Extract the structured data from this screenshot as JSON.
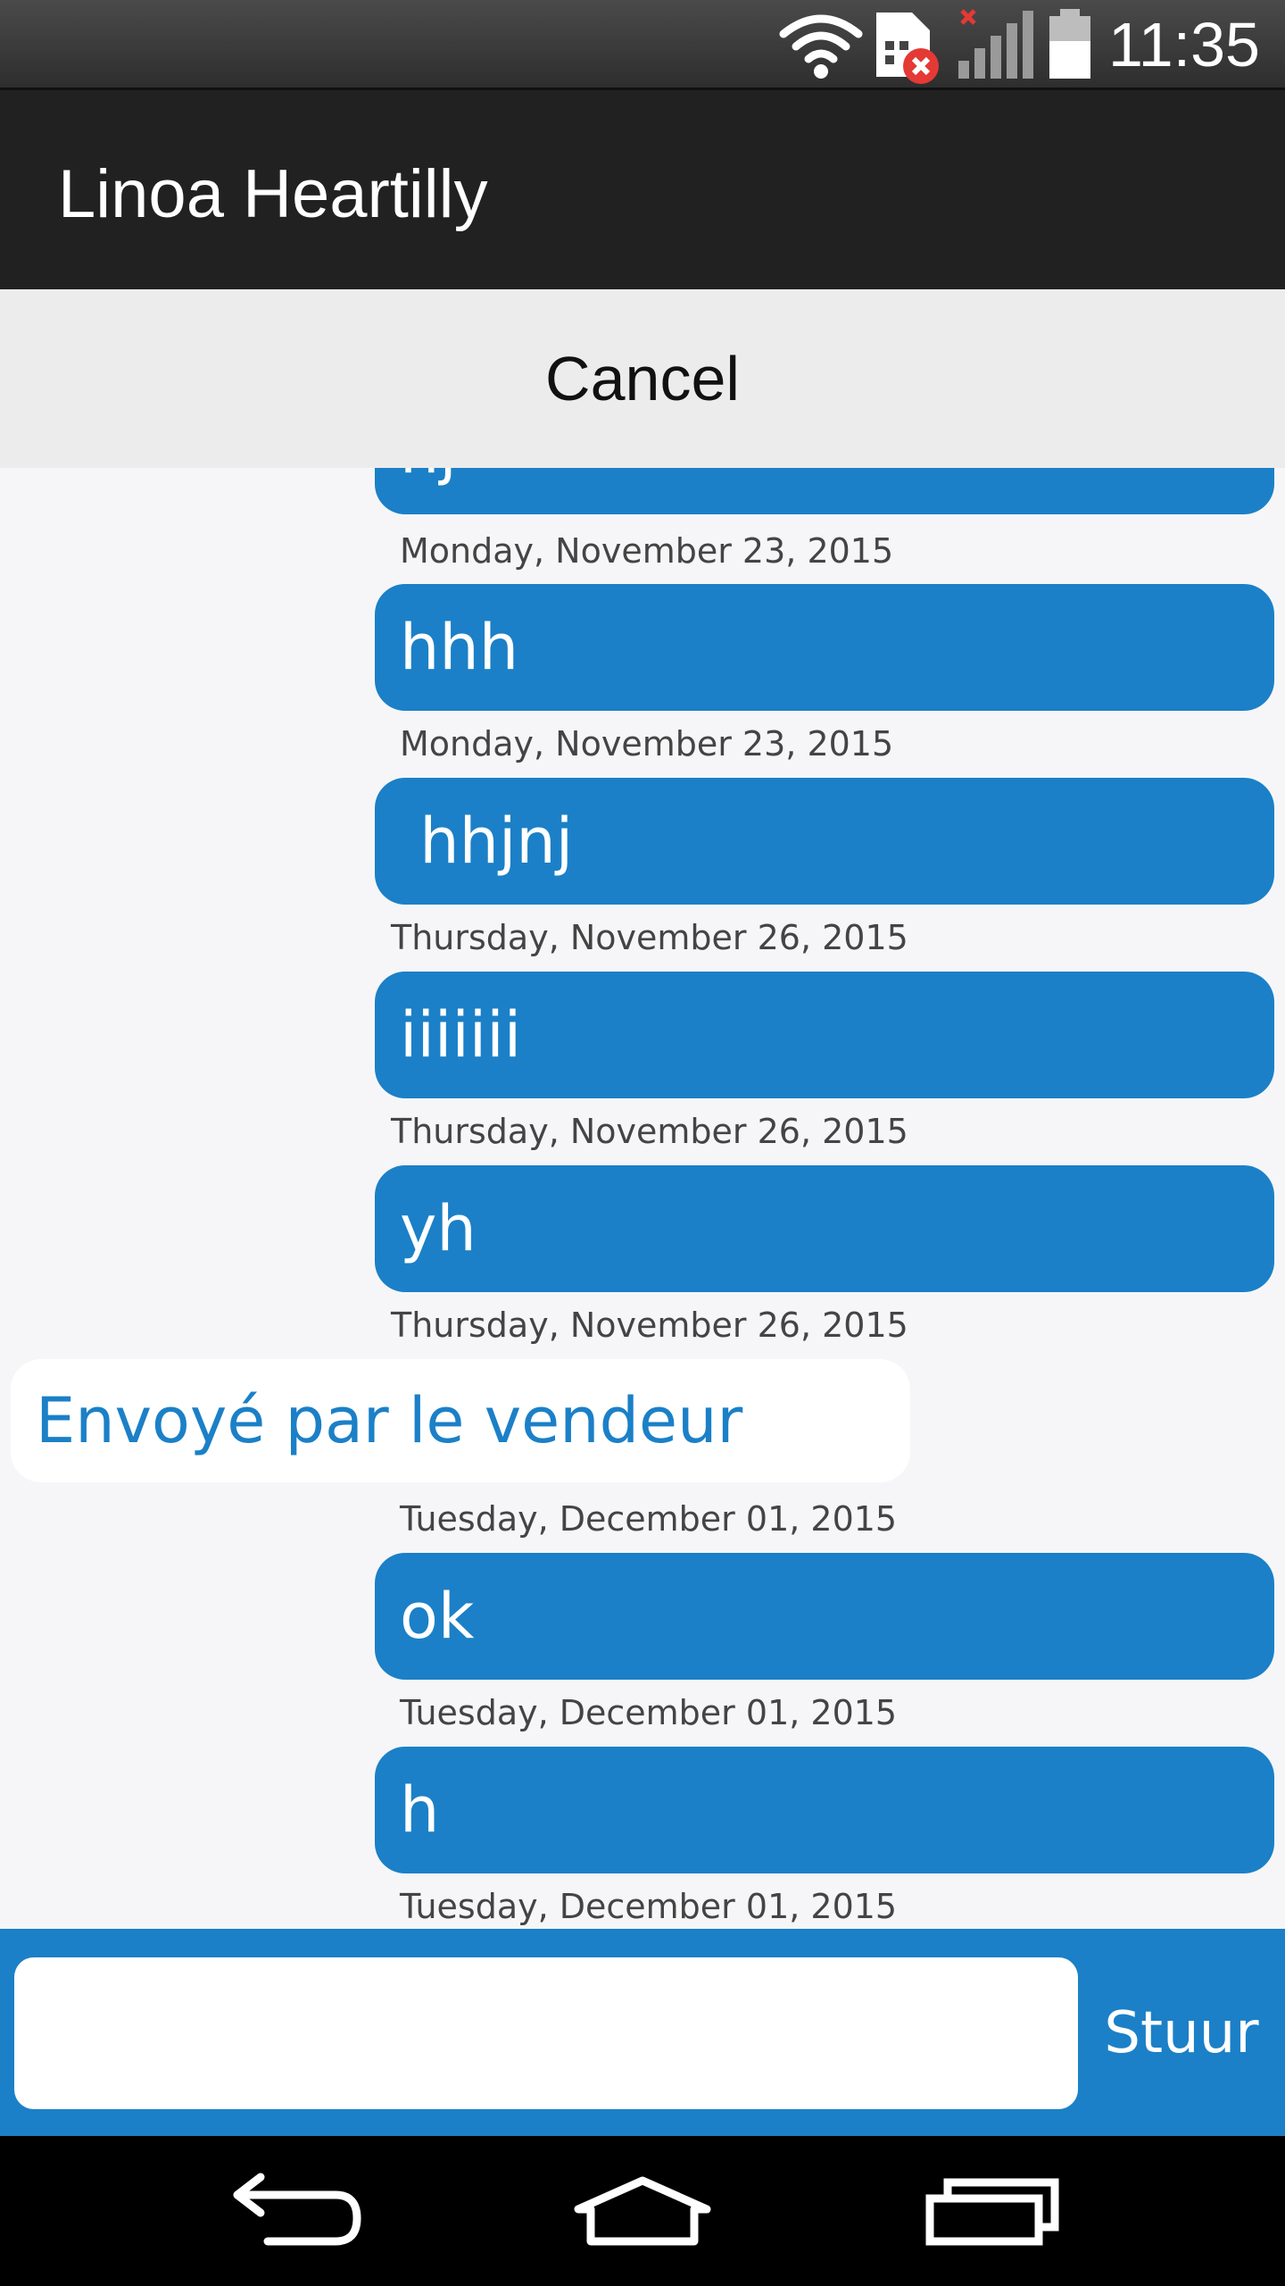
{
  "status_bar": {
    "time": "11:35",
    "icons": [
      "wifi-icon",
      "sim-error-icon",
      "signal-icon",
      "battery-icon"
    ]
  },
  "app_bar": {
    "title": "Linoa Heartilly"
  },
  "cancel": {
    "label": "Cancel"
  },
  "messages": [
    {
      "text": "hj",
      "stamp": "Monday, November 23, 2015"
    },
    {
      "text": "hhh",
      "stamp": "Monday, November 23, 2015"
    },
    {
      "text": " hhjnj",
      "stamp": "Thursday, November 26, 2015"
    },
    {
      "text": "iiiiiii",
      "stamp": "Thursday, November 26, 2015"
    },
    {
      "text": "yh",
      "stamp": "Thursday, November 26, 2015"
    },
    {
      "text": "Envoyé par le vendeur",
      "stamp": "Tuesday, December 01, 2015"
    },
    {
      "text": "ok",
      "stamp": "Tuesday, December 01, 2015"
    },
    {
      "text": "h",
      "stamp": "Tuesday, December 01, 2015"
    }
  ],
  "composer": {
    "value": "",
    "placeholder": "",
    "send_label": "Stuur"
  },
  "nav_bar": {
    "icons": [
      "back-icon",
      "home-icon",
      "recent-apps-icon"
    ]
  },
  "colors": {
    "accent": "#1b80c7",
    "app_bar": "#212121",
    "background": "#f6f6f8"
  }
}
